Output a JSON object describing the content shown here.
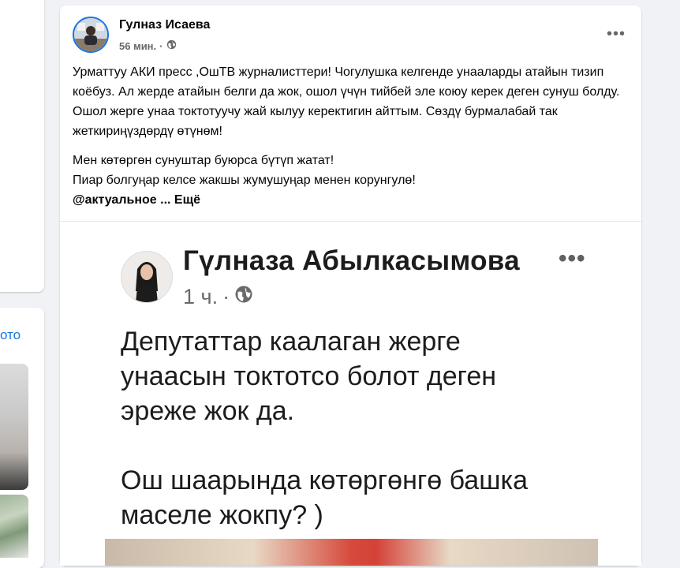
{
  "left": {
    "link_text": "ото"
  },
  "post": {
    "author": "Гулназ Исаева",
    "time": "56 мин.",
    "separator": "·",
    "more_icon": "more-horizontal-icon",
    "paragraph1": "Урматтуу  АКИ пресс ,ОшТВ журналисттери!  Чогулушка келгенде унааларды атайын тизип коёбуз. Ал жерде атайын белги да жок, ошол үчүн тийбей эле коюу керек деген сунуш болду. Ошол жерге унаа токтотуучу жай кылуу керектигин айттым. Сөздү бурмалабай так жеткириңүздөрдү өтүнөм!",
    "paragraph2": " Мен көтөргөн сунуштар буюрса бүтүп жатат!",
    "paragraph3": "Пиар болгуңар келсе жакшы жумушуңар менен корунгулө!",
    "hashtag": "@актуальное",
    "see_more": "... Ещё"
  },
  "embedded": {
    "name": "Гүлназа Абылкасымова",
    "time": "1 ч.",
    "separator": "·",
    "line1": "Депутаттар каалаган жерге",
    "line2": "унаасын токтотсо  болот деген",
    "line3": "эреже жок да.",
    "line4": "Ош шаарында көтөргөнгө башка",
    "line5": "маселе жокпу? )"
  },
  "colors": {
    "accent": "#1b74e4",
    "background": "#f0f2f5",
    "secondary_text": "#65676b"
  }
}
